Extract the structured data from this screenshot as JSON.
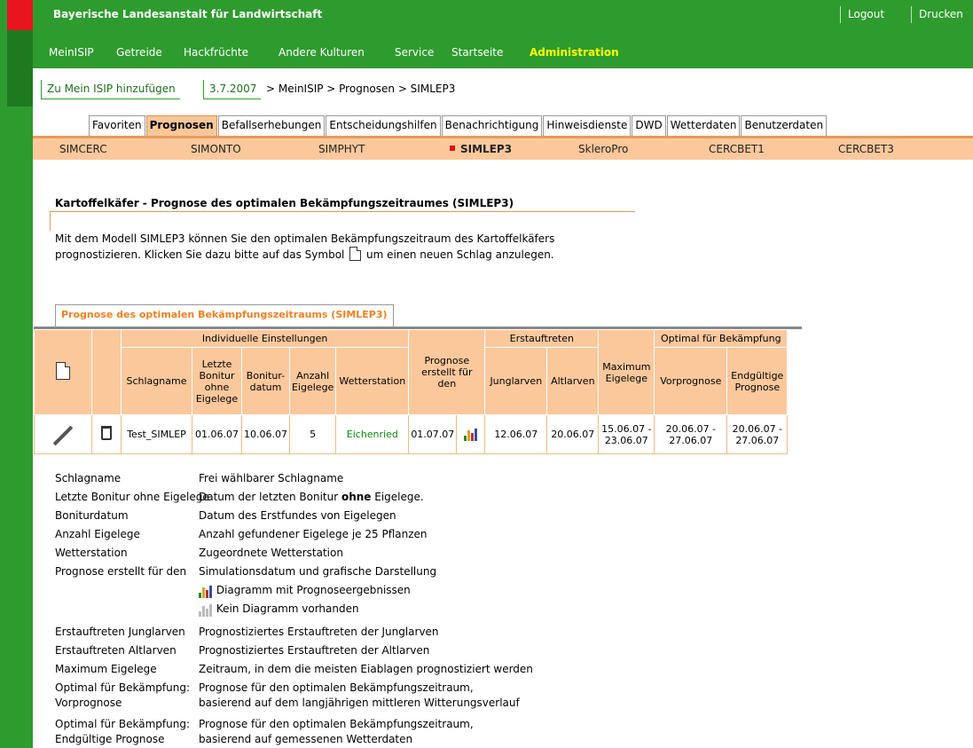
{
  "header": {
    "org_title": "Bayerische Landesanstalt für Landwirtschaft",
    "logout": "Logout",
    "print": "Drucken"
  },
  "nav": {
    "items": [
      "MeinISIP",
      "Getreide",
      "Hackfrüchte",
      "Andere Kulturen",
      "Service",
      "Startseite",
      "Administration"
    ]
  },
  "breadcrumb": {
    "add_label": "Zu Mein ISIP hinzufügen",
    "date": "3.7.2007",
    "path": "> MeinISIP > Prognosen > SIMLEP3"
  },
  "tabs": [
    "Favoriten",
    "Prognosen",
    "Befallserhebungen",
    "Entscheidungshilfen",
    "Benachrichtigung",
    "Hinweisdienste",
    "DWD",
    "Wetterdaten",
    "Benutzerdaten"
  ],
  "subnav": [
    "SIMCERC",
    "SIMONTO",
    "SIMPHYT",
    "SIMLEP3",
    "SkleroPro",
    "CERCBET1",
    "CERCBET3"
  ],
  "content": {
    "heading": "Kartoffelkäfer - Prognose des optimalen Bekämpfungszeitraumes (SIMLEP3)",
    "intro_1": "Mit dem Modell SIMLEP3 können Sie den optimalen Bekämpfungszeitraum des Kartoffelkäfers",
    "intro_2a": "prognostizieren. Klicken Sie dazu bitte auf das Symbol",
    "intro_2b": "um einen neuen Schlag anzulegen."
  },
  "panel": {
    "tab_label": "Prognose des optimalen Bekämpfungszeitraums (SIMLEP3)"
  },
  "table": {
    "group_individual": "Individuelle Einstellungen",
    "group_prognose": "Prognose erstellt für den",
    "group_erst": "Erstauftreten",
    "group_max": "Maximum Eigelege",
    "group_optimal": "Optimal für Bekämpfung",
    "col_schlagname": "Schlagname",
    "col_letzte": "Letzte Bonitur ohne Eigelege",
    "col_bonitur": "Bonitur-datum",
    "col_anzahl": "Anzahl Eigelege",
    "col_wetter": "Wetterstation",
    "col_jung": "Junglarven",
    "col_alt": "Altlarven",
    "col_vor": "Vorprognose",
    "col_end": "Endgültige Prognose",
    "row": {
      "schlagname": "Test_SIMLEP",
      "letzte": "01.06.07",
      "bonitur": "10.06.07",
      "anzahl": "5",
      "wetter": "Eichenried",
      "prognose": "01.07.07",
      "jung": "12.06.07",
      "alt": "20.06.07",
      "max_a": "15.06.07 -",
      "max_b": "23.06.07",
      "vor_a": "20.06.07 -",
      "vor_b": "27.06.07",
      "end_a": "20.06.07 -",
      "end_b": "27.06.07"
    }
  },
  "legend": {
    "k1": "Schlagname",
    "v1": "Frei wählbarer Schlagname",
    "k2": "Letzte Bonitur ohne Eigelege",
    "v2a": "Datum der letzten Bonitur ",
    "v2b": "ohne",
    "v2c": " Eigelege.",
    "k3": "Boniturdatum",
    "v3": "Datum des Erstfundes von Eigelegen",
    "k4": "Anzahl Eigelege",
    "v4": "Anzahl gefundener Eigelege je 25 Pflanzen",
    "k5": "Wetterstation",
    "v5": "Zugeordnete Wetterstation",
    "k6": "Prognose erstellt für den",
    "v6": "Simulationsdatum und grafische Darstellung",
    "v6b": "Diagramm mit Prognoseergebnissen",
    "v6c": "Kein Diagramm vorhanden",
    "k7": "Erstauftreten Junglarven",
    "v7": "Prognostiziertes Erstauftreten der Junglarven",
    "k8": "Erstauftreten Altlarven",
    "v8": "Prognostiziertes Erstauftreten der Altlarven",
    "k9": "Maximum Eigelege",
    "v9": "Zeitraum, in dem die meisten Eiablagen prognostiziert werden",
    "k10a": "Optimal für Bekämpfung:",
    "k10b": "Vorprognose",
    "v10a": "Prognose für den optimalen Bekämpfungszeitraum,",
    "v10b": "basierend auf dem langjährigen mittleren Witterungsverlauf",
    "k11a": "Optimal für Bekämpfung:",
    "k11b": "Endgültige Prognose",
    "v11a": "Prognose für den optimalen Bekämpfungszeitraum,",
    "v11b": "basierend auf gemessenen Wetterdaten"
  },
  "colors": {
    "green": "#2e9b2e",
    "orange_light": "#fbc89c",
    "orange": "#e89a5a",
    "red": "#e8141e",
    "active_nav": "#ffff00"
  }
}
